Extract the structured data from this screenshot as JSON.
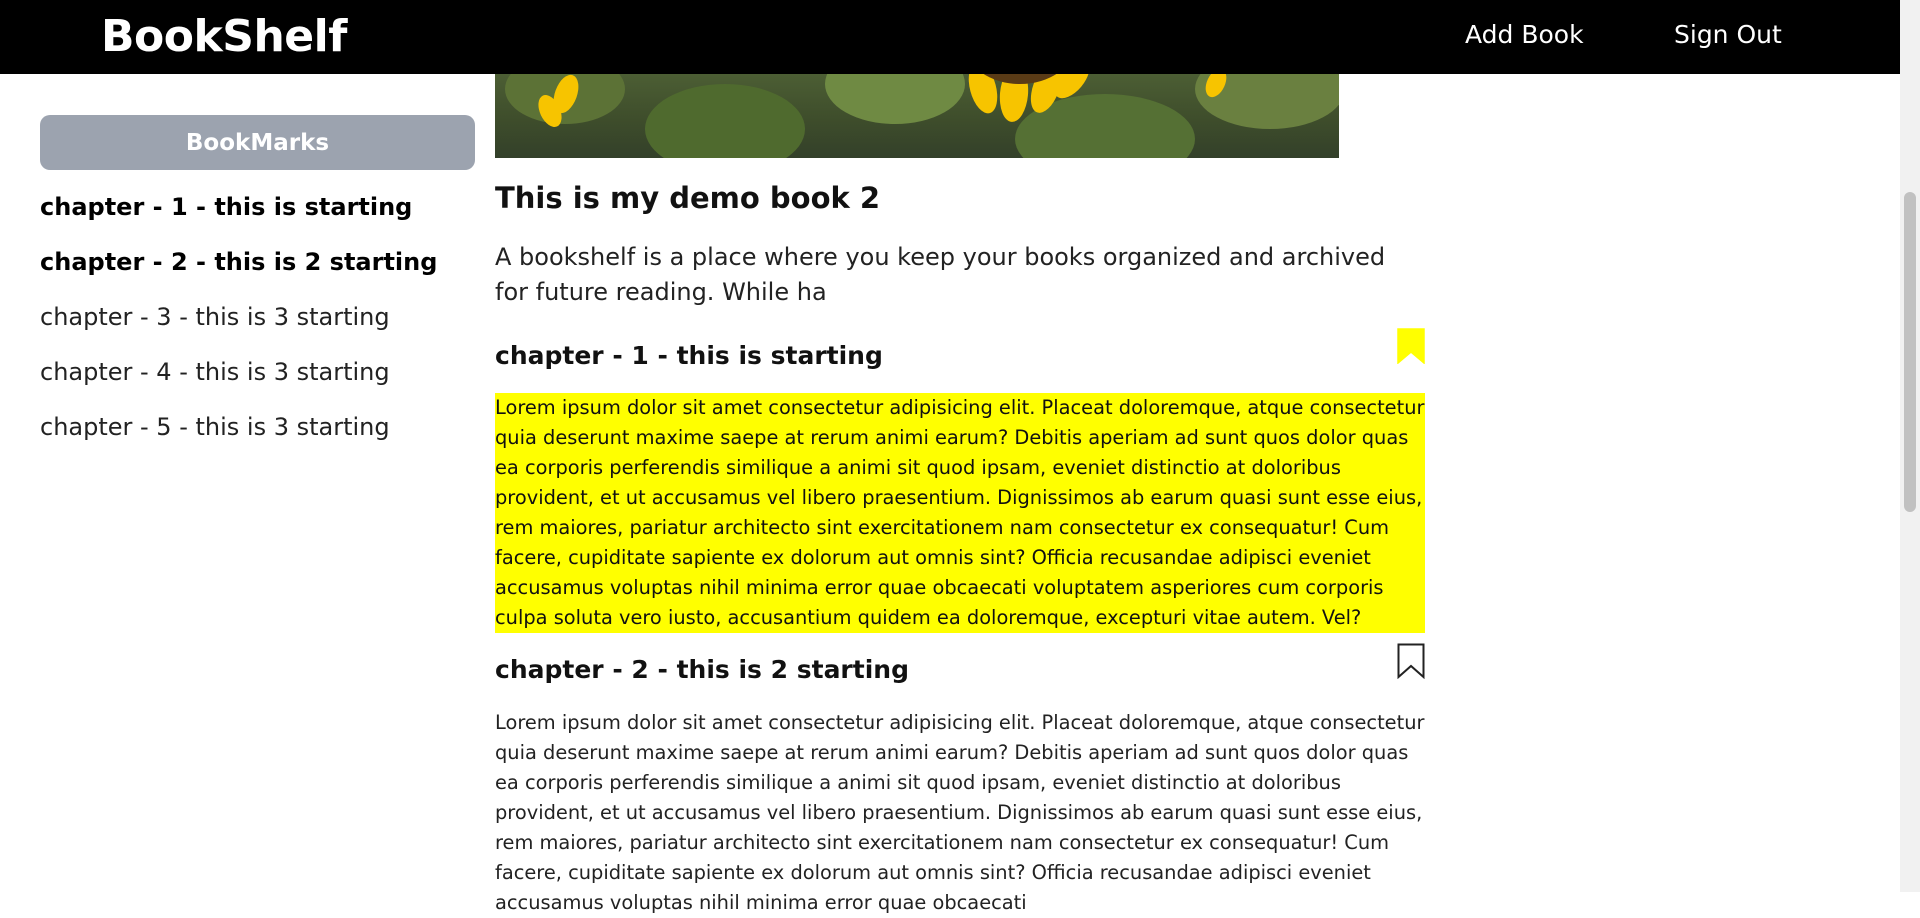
{
  "navbar": {
    "brand": "BookShelf",
    "add_book": "Add Book",
    "sign_out": "Sign Out"
  },
  "sidebar": {
    "header": "BookMarks",
    "items": [
      {
        "label": "chapter - 1 - this is starting",
        "bookmarked": true
      },
      {
        "label": "chapter - 2 - this is 2 starting",
        "bookmarked": true
      },
      {
        "label": "chapter - 3 - this is 3 starting",
        "bookmarked": false
      },
      {
        "label": "chapter - 4 - this is 3 starting",
        "bookmarked": false
      },
      {
        "label": "chapter - 5 - this is 3 starting",
        "bookmarked": false
      }
    ]
  },
  "book": {
    "title": "This is my demo book 2",
    "description": "A bookshelf is a place where you keep your books organized and archived for future reading. While ha",
    "chapters": [
      {
        "title": "chapter - 1 - this is starting",
        "bookmark_icon": "bookmark-filled-icon",
        "highlighted": true,
        "body": "Lorem ipsum dolor sit amet consectetur adipisicing elit. Placeat doloremque, atque consectetur quia deserunt maxime saepe at rerum animi earum? Debitis aperiam ad sunt quos dolor quas ea corporis perferendis similique a animi sit quod ipsam, eveniet distinctio at doloribus provident, et ut accusamus vel libero praesentium. Dignissimos ab earum quasi sunt esse eius, rem maiores, pariatur architecto sint exercitationem nam consectetur ex consequatur! Cum facere, cupiditate sapiente ex dolorum aut omnis sint? Officia recusandae adipisci eveniet accusamus voluptas nihil minima error quae obcaecati voluptatem asperiores cum corporis culpa soluta vero iusto, accusantium quidem ea doloremque, excepturi vitae autem. Vel?"
      },
      {
        "title": "chapter - 2 - this is 2 starting",
        "bookmark_icon": "bookmark-outline-icon",
        "highlighted": false,
        "body": "Lorem ipsum dolor sit amet consectetur adipisicing elit. Placeat doloremque, atque consectetur quia deserunt maxime saepe at rerum animi earum? Debitis aperiam ad sunt quos dolor quas ea corporis perferendis similique a animi sit quod ipsam, eveniet distinctio at doloribus provident, et ut accusamus vel libero praesentium. Dignissimos ab earum quasi sunt esse eius, rem maiores, pariatur architecto sint exercitationem nam consectetur ex consequatur! Cum facere, cupiditate sapiente ex dolorum aut omnis sint? Officia recusandae adipisci eveniet accusamus voluptas nihil minima error quae obcaecati"
      }
    ]
  },
  "colors": {
    "navbar_bg": "#000000",
    "bookmarks_header_bg": "#9ca3af",
    "highlight": "#ffff00",
    "bookmark_filled": "#ffff00"
  }
}
